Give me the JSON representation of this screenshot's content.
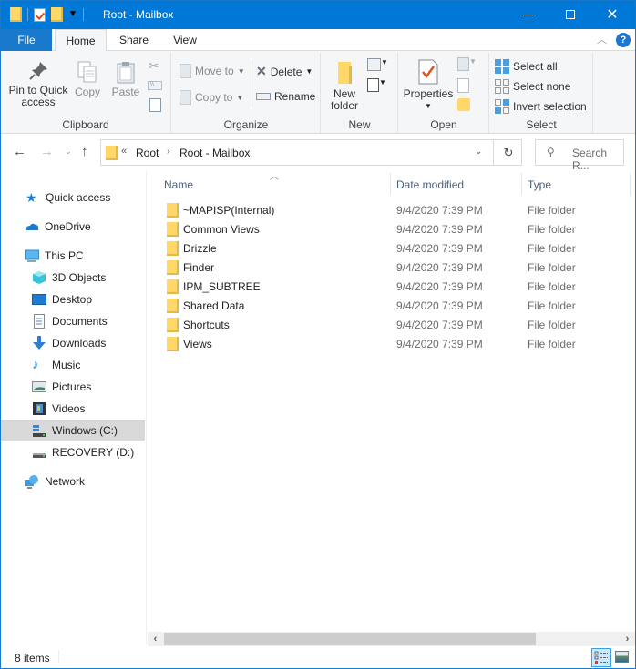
{
  "window": {
    "title": "Root - Mailbox",
    "controls": {
      "minimize": "minimize",
      "maximize": "maximize",
      "close": "✕"
    }
  },
  "ribbon": {
    "tabs": [
      {
        "label": "File"
      },
      {
        "label": "Home"
      },
      {
        "label": "Share"
      },
      {
        "label": "View"
      }
    ],
    "help": "?",
    "groups": {
      "clipboard": {
        "label": "Clipboard",
        "pin": "Pin to Quick access",
        "pin_line1": "Pin to Quick",
        "pin_line2": "access",
        "copy": "Copy",
        "paste": "Paste"
      },
      "organize": {
        "label": "Organize",
        "move_to": "Move to",
        "copy_to": "Copy to",
        "delete": "Delete",
        "rename": "Rename"
      },
      "new": {
        "label": "New",
        "new_folder_line1": "New",
        "new_folder_line2": "folder"
      },
      "open": {
        "label": "Open",
        "properties": "Properties"
      },
      "select": {
        "label": "Select",
        "select_all": "Select all",
        "select_none": "Select none",
        "invert_selection": "Invert selection"
      }
    }
  },
  "address_bar": {
    "overflow": "«",
    "breadcrumbs": [
      "Root",
      "Root - Mailbox"
    ],
    "separator": "›",
    "search_placeholder": "Search R..."
  },
  "sidebar": {
    "items": [
      {
        "label": "Quick access",
        "icon": "star-icon"
      },
      {
        "label": "OneDrive",
        "icon": "cloud-icon"
      },
      {
        "label": "This PC",
        "icon": "computer-icon"
      },
      {
        "label": "3D Objects",
        "icon": "cube-icon"
      },
      {
        "label": "Desktop",
        "icon": "desktop-icon"
      },
      {
        "label": "Documents",
        "icon": "document-icon"
      },
      {
        "label": "Downloads",
        "icon": "download-icon"
      },
      {
        "label": "Music",
        "icon": "music-icon"
      },
      {
        "label": "Pictures",
        "icon": "picture-icon"
      },
      {
        "label": "Videos",
        "icon": "video-icon"
      },
      {
        "label": "Windows (C:)",
        "icon": "drive-icon",
        "selected": true
      },
      {
        "label": "RECOVERY (D:)",
        "icon": "drive-icon"
      },
      {
        "label": "Network",
        "icon": "network-icon"
      }
    ]
  },
  "file_list": {
    "columns": [
      "Name",
      "Date modified",
      "Type"
    ],
    "rows": [
      {
        "name": "~MAPISP(Internal)",
        "date": "9/4/2020 7:39 PM",
        "type": "File folder"
      },
      {
        "name": "Common Views",
        "date": "9/4/2020 7:39 PM",
        "type": "File folder"
      },
      {
        "name": "Drizzle",
        "date": "9/4/2020 7:39 PM",
        "type": "File folder"
      },
      {
        "name": "Finder",
        "date": "9/4/2020 7:39 PM",
        "type": "File folder"
      },
      {
        "name": "IPM_SUBTREE",
        "date": "9/4/2020 7:39 PM",
        "type": "File folder"
      },
      {
        "name": "Shared Data",
        "date": "9/4/2020 7:39 PM",
        "type": "File folder"
      },
      {
        "name": "Shortcuts",
        "date": "9/4/2020 7:39 PM",
        "type": "File folder"
      },
      {
        "name": "Views",
        "date": "9/4/2020 7:39 PM",
        "type": "File folder"
      }
    ]
  },
  "status_bar": {
    "item_count": "8 items"
  },
  "colors": {
    "accent": "#0078d7",
    "folder": "#ffd869",
    "selected_nav": "#d9d9d9"
  }
}
